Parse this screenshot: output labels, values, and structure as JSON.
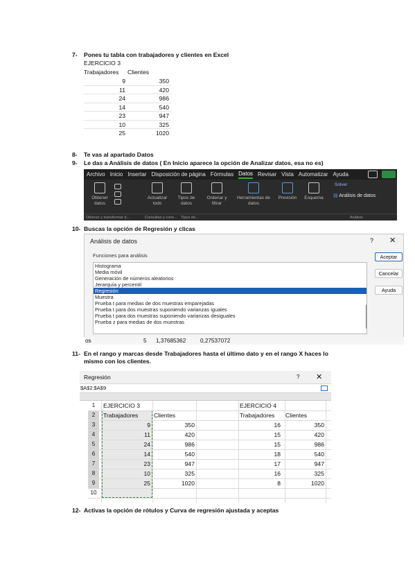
{
  "steps": {
    "s7": {
      "num": "7-",
      "text": "Pones tu tabla con trabajadores y clientes en Excel"
    },
    "s8": {
      "num": "8-",
      "text": "Te vas al apartado Datos"
    },
    "s9": {
      "num": "9-",
      "text": "Le das a Análisis de datos ( En Inicio aparece la opción de Analizar datos, esa no es)"
    },
    "s10": {
      "num": "10-",
      "text": "Buscas la opción de Regresión y clicas"
    },
    "s11": {
      "num": "11-",
      "text": "En el rango y marcas desde Trabajadores hasta el último dato y en el rango X haces lo",
      "text2": "mismo con los clientes."
    },
    "s12": {
      "num": "12-",
      "text": "Activas la opción de rótulos y Curva de regresión ajustada y aceptas"
    }
  },
  "table7": {
    "title": "EJERCICIO 3",
    "headers": [
      "Trabajadores",
      "Clientes"
    ],
    "rows": [
      [
        "9",
        "350"
      ],
      [
        "11",
        "420"
      ],
      [
        "24",
        "986"
      ],
      [
        "14",
        "540"
      ],
      [
        "23",
        "947"
      ],
      [
        "10",
        "325"
      ],
      [
        "25",
        "1020"
      ]
    ]
  },
  "ribbon": {
    "tabs": [
      "Archivo",
      "Inicio",
      "Insertar",
      "Disposición de página",
      "Fórmulas",
      "Datos",
      "Revisar",
      "Vista",
      "Automatizar",
      "Ayuda"
    ],
    "active_tab": "Datos",
    "groups": [
      {
        "label": "Obtener datos"
      },
      {
        "label": "Actualizar todo"
      },
      {
        "label": "Tipos de datos"
      },
      {
        "label": "Ordenar y filtrar"
      },
      {
        "label": "Herramientas de datos"
      },
      {
        "label": "Previsión"
      },
      {
        "label": "Esquema"
      }
    ],
    "solver": "Solver",
    "analisis": "Análisis de datos",
    "group_labels": [
      "Obtener y transformar d...",
      "Consultas y cone...",
      "Tipos de...",
      "Análisis"
    ]
  },
  "dialog": {
    "title": "Análisis de datos",
    "help": "?",
    "close": "✕",
    "functions_label": "Funciones para análisis",
    "items": [
      "Histograma",
      "Media móvil",
      "Generación de números aleatorios",
      "Jerarquía y percentil",
      "Regresión",
      "Muestra",
      "Prueba t para medias de dos muestras emparejadas",
      "Prueba t para dos muestras suponiendo varianzas iguales",
      "Prueba t para dos muestras suponiendo varianzas desiguales",
      "Prueba z para medias de dos muestras"
    ],
    "selected_index": 4,
    "buttons": {
      "ok": "Aceptar",
      "cancel": "Cancelar",
      "help": "Ayuda"
    },
    "below": {
      "c1": "os",
      "c2": "5",
      "c3": "1,37685362",
      "c4": "0,27537072"
    }
  },
  "regresion": {
    "title": "Regresión",
    "help": "?",
    "close": "✕",
    "range": "$A$2:$A$9",
    "row_numbers": [
      "1",
      "2",
      "3",
      "4",
      "5",
      "6",
      "7",
      "8",
      "9",
      "10"
    ],
    "left": {
      "title": "EJERCICIO 3",
      "headers": [
        "Trabajadores",
        "Clientes"
      ],
      "rows": [
        [
          "9",
          "350"
        ],
        [
          "11",
          "420"
        ],
        [
          "24",
          "986"
        ],
        [
          "14",
          "540"
        ],
        [
          "23",
          "947"
        ],
        [
          "10",
          "325"
        ],
        [
          "25",
          "1020"
        ]
      ]
    },
    "right": {
      "title": "EJERCICIO 4",
      "headers": [
        "Trabajadores",
        "Clientes"
      ],
      "rows": [
        [
          "16",
          "350"
        ],
        [
          "15",
          "420"
        ],
        [
          "15",
          "986"
        ],
        [
          "18",
          "540"
        ],
        [
          "17",
          "947"
        ],
        [
          "16",
          "325"
        ],
        [
          "8",
          "1020"
        ]
      ]
    }
  }
}
